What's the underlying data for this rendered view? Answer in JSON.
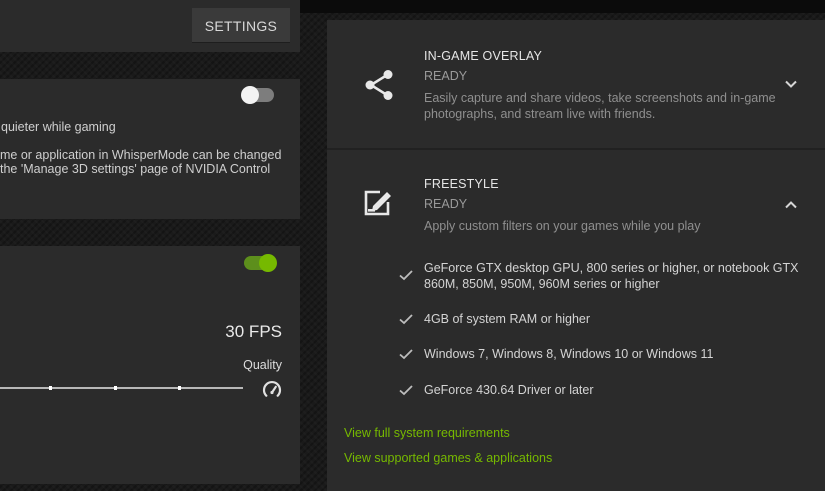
{
  "left": {
    "settings_label": "SETTINGS",
    "whispermode": {
      "line1": "quieter while gaming",
      "line2": "me or application in WhisperMode can be changed",
      "line3": "the 'Manage 3D settings' page of NVIDIA Control"
    },
    "battery_boost": {
      "fps": "30 FPS",
      "quality_label": "Quality"
    }
  },
  "features": {
    "overlay": {
      "title": "IN-GAME OVERLAY",
      "status": "READY",
      "description": "Easily capture and share videos, take screenshots and in-game photographs, and stream live with friends."
    },
    "freestyle": {
      "title": "FREESTYLE",
      "status": "READY",
      "description": "Apply custom filters on your games while you play",
      "requirements": [
        "GeForce GTX desktop GPU, 800 series or higher, or notebook GTX 860M, 850M, 950M, 960M series or higher",
        "4GB of system RAM or higher",
        "Windows 7, Windows 8, Windows 10 or Windows 11",
        "GeForce 430.64 Driver or later"
      ]
    }
  },
  "links": {
    "full_requirements": "View full system requirements",
    "supported_games": "View supported games & applications"
  },
  "colors": {
    "accent_green": "#76b900",
    "panel_bg": "#2b2b2b",
    "text_primary": "#e6e6e6",
    "text_muted": "#8f8f8f"
  },
  "icons": {
    "overlay": "share-icon",
    "freestyle": "freestyle-edit-icon",
    "expand": "chevron-down-icon",
    "collapse": "chevron-up-icon",
    "requirement": "checkmark-icon",
    "quality": "speed-gauge-icon"
  }
}
